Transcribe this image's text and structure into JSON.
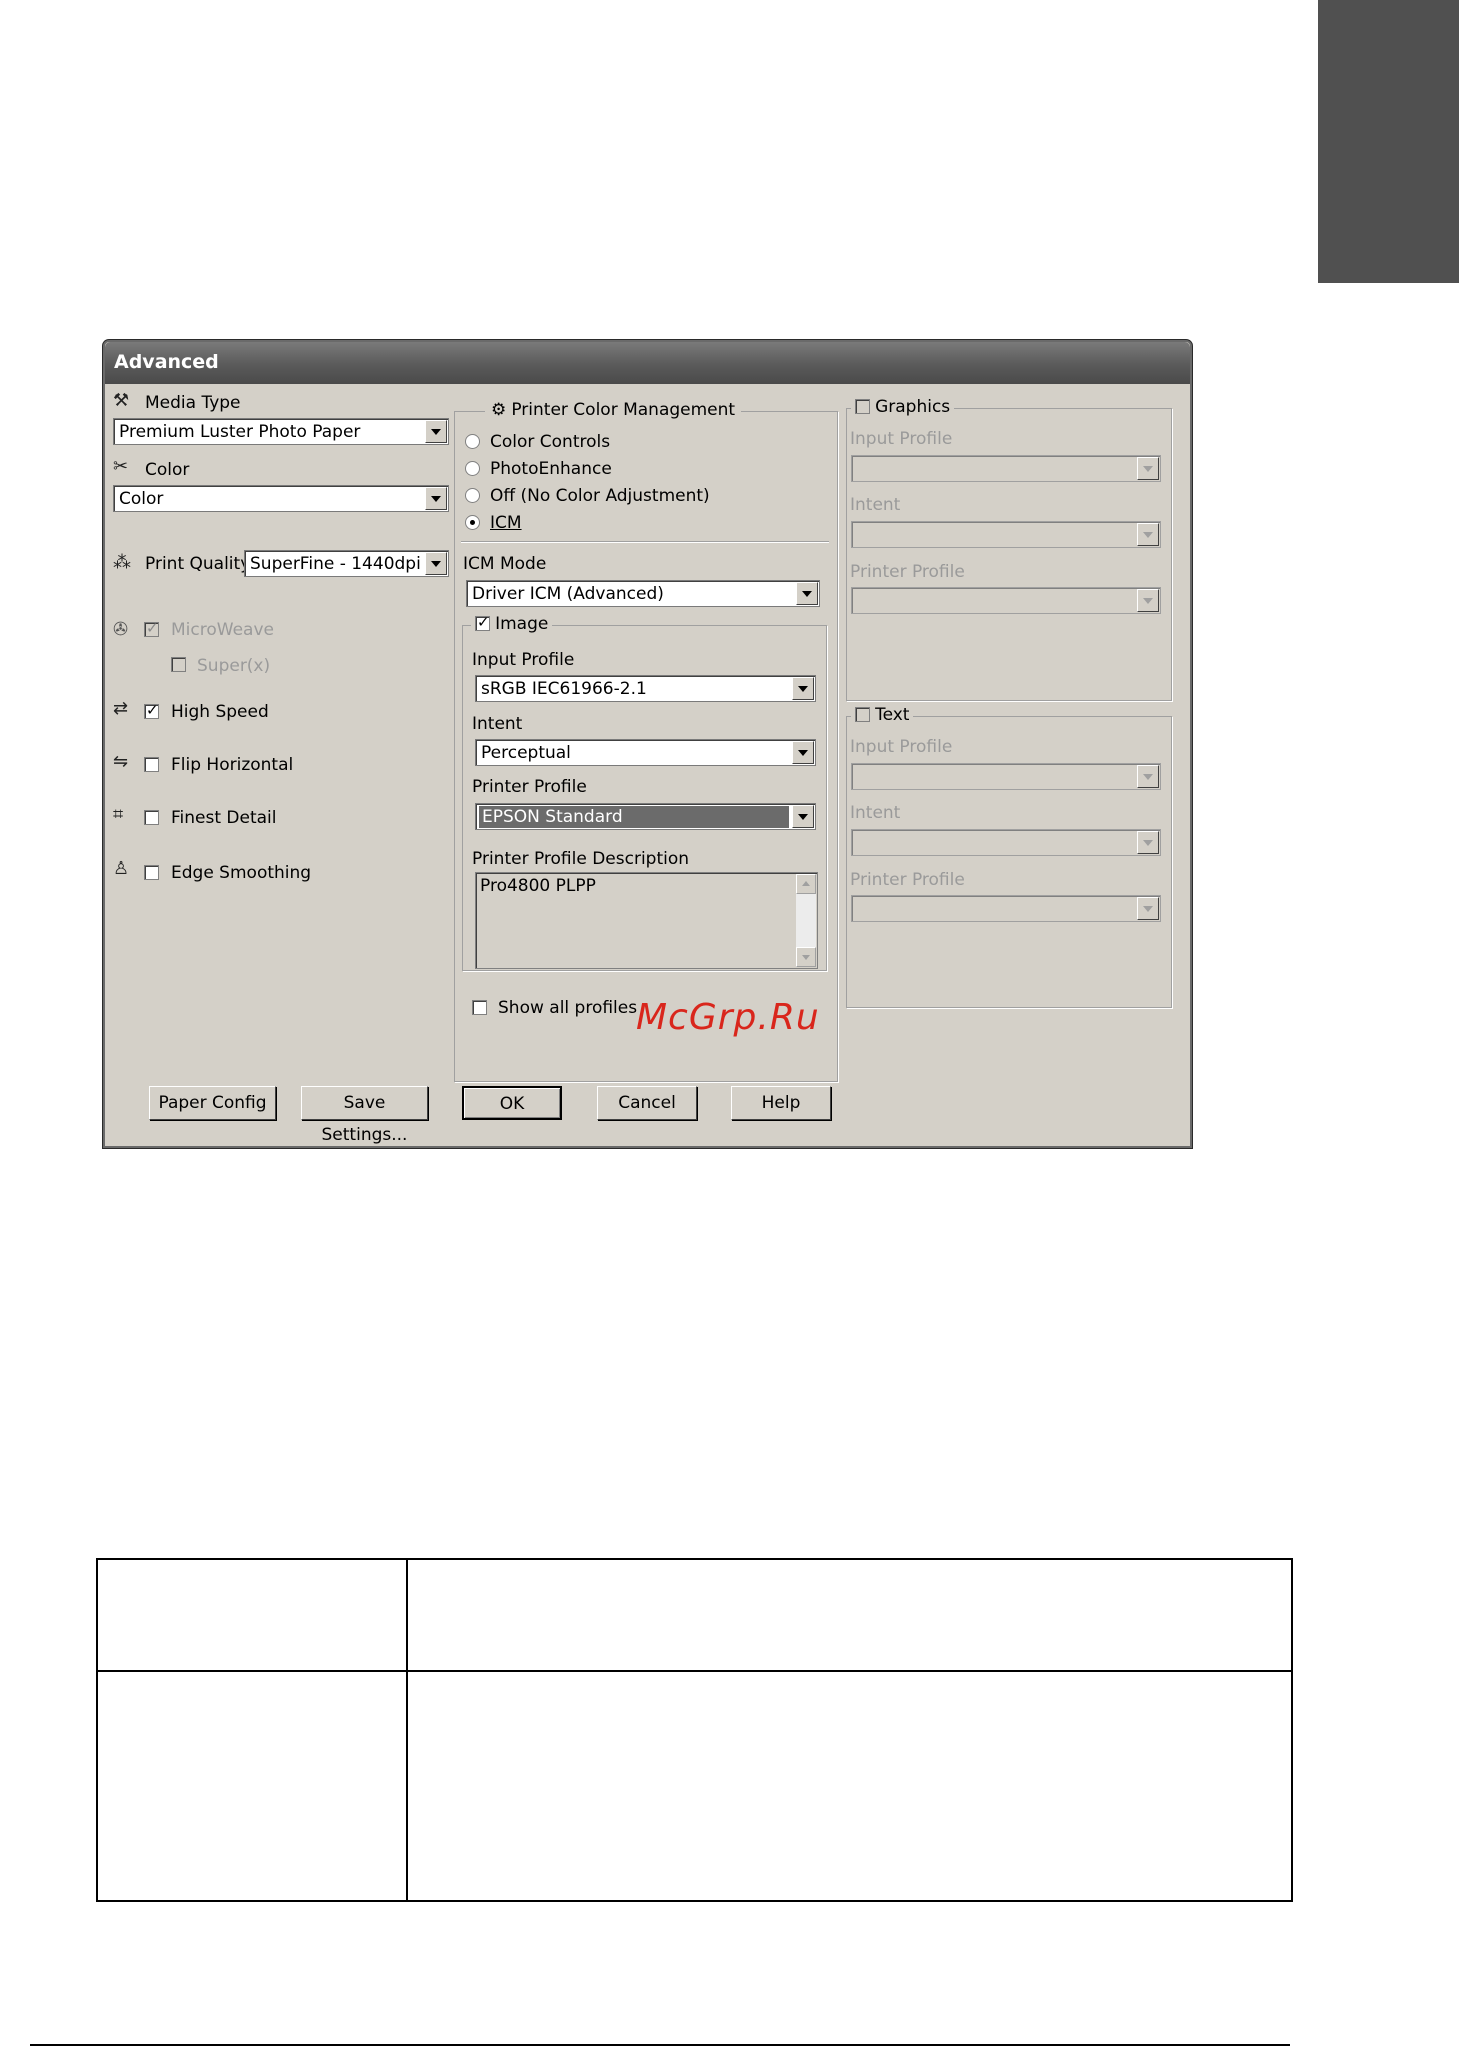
{
  "dialog": {
    "title": "Advanced",
    "left": {
      "media_type_label": "Media Type",
      "media_type_value": "Premium Luster Photo Paper",
      "color_label": "Color",
      "color_value": "Color",
      "print_quality_label": "Print Quality",
      "print_quality_value": "SuperFine - 1440dpi",
      "microweave_label": "MicroWeave",
      "superx_label": "Super(x)",
      "high_speed_label": "High Speed",
      "flip_horizontal_label": "Flip Horizontal",
      "finest_detail_label": "Finest Detail",
      "edge_smoothing_label": "Edge Smoothing"
    },
    "pcm": {
      "group_label": "Printer Color Management",
      "options": [
        "Color Controls",
        "PhotoEnhance",
        "Off (No Color Adjustment)",
        "ICM"
      ],
      "selected": "ICM",
      "icm_mode_label": "ICM Mode",
      "icm_mode_value": "Driver ICM (Advanced)",
      "image_label": "Image",
      "input_profile_label": "Input Profile",
      "input_profile_value": "sRGB IEC61966-2.1",
      "intent_label": "Intent",
      "intent_value": "Perceptual",
      "printer_profile_label": "Printer Profile",
      "printer_profile_value": "EPSON Standard",
      "printer_profile_desc_label": "Printer Profile Description",
      "printer_profile_desc_value": "Pro4800 PLPP",
      "show_all_profiles_label": "Show all profiles"
    },
    "graphics": {
      "label": "Graphics",
      "input_profile_label": "Input Profile",
      "intent_label": "Intent",
      "printer_profile_label": "Printer Profile"
    },
    "text": {
      "label": "Text",
      "input_profile_label": "Input Profile",
      "intent_label": "Intent",
      "printer_profile_label": "Printer Profile"
    },
    "buttons": {
      "paper_config": "Paper Config",
      "save_settings": "Save Settings...",
      "ok": "OK",
      "cancel": "Cancel",
      "help": "Help"
    },
    "watermark": "McGrp.Ru"
  },
  "colors": {
    "dialog_face": "#d4d0c8",
    "title_bar": "#5a5a5a",
    "watermark": "#d9261c",
    "tab_marker": "#505050"
  }
}
